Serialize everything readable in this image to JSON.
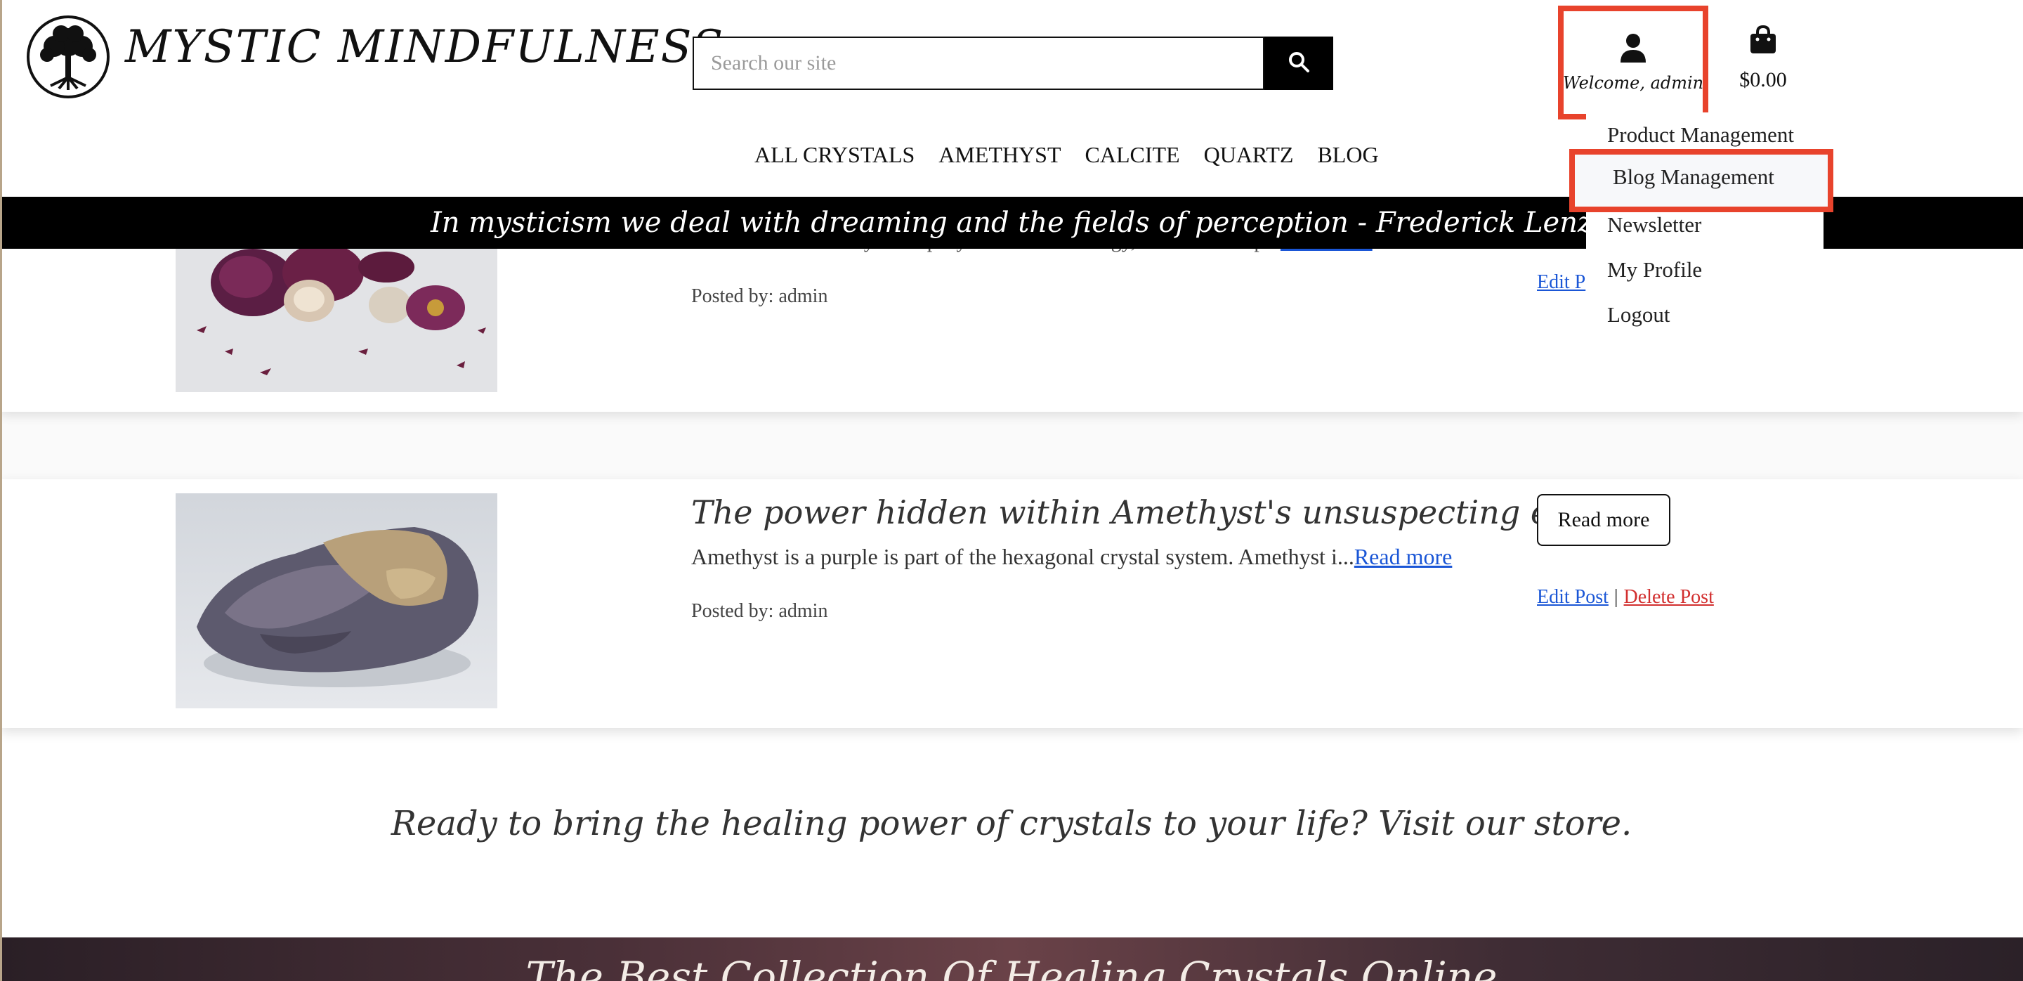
{
  "header": {
    "brand": "MYSTIC MINDFULNESS",
    "search_placeholder": "Search our site",
    "account_label": "Welcome, admin",
    "cart_total": "$0.00"
  },
  "nav": {
    "items": [
      "ALL CRYSTALS",
      "AMETHYST",
      "CALCITE",
      "QUARTZ",
      "BLOG"
    ]
  },
  "account_menu": {
    "items": [
      "Product Management",
      "Blog Management",
      "Newsletter",
      "My Profile",
      "Logout"
    ],
    "highlighted": "Blog Management"
  },
  "quote": "In mysticism we deal with dreaming and the fields of perception - Frederick Lenz",
  "posts": [
    {
      "excerpt_fragment": "Calcite has the ability to amplify and cleanse energy, as well as help...",
      "read_more_link": "Read more",
      "posted_by": "Posted by: admin",
      "edit_label_fragment": "Edit P"
    },
    {
      "title": "The power hidden within Amethyst's unsuspecting exterior",
      "excerpt": "Amethyst is a purple is part of the hexagonal crystal system. Amethyst i...",
      "read_more_link": "Read more",
      "read_more_button": "Read more",
      "posted_by": "Posted by: admin",
      "edit_label": "Edit Post",
      "separator": "|",
      "delete_label": "Delete Post"
    }
  ],
  "cta": "Ready to bring the healing power of crystals to your life? Visit our store.",
  "footer": {
    "title": "The Best Collection Of Healing Crystals Online"
  },
  "colors": {
    "highlight_border": "#e8432c",
    "link": "#1a56d6",
    "delete": "#d22f2f",
    "banner": "#000000"
  }
}
